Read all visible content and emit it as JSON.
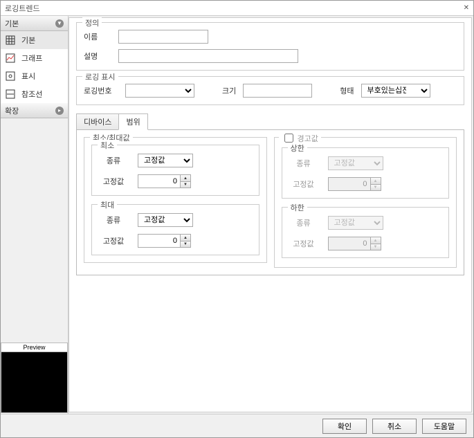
{
  "window": {
    "title": "로깅트렌드"
  },
  "sidebar": {
    "sections": [
      {
        "label": "기본",
        "items": [
          {
            "label": "기본",
            "icon": "table-icon",
            "selected": true
          },
          {
            "label": "그래프",
            "icon": "chart-icon"
          },
          {
            "label": "표시",
            "icon": "eye-icon"
          },
          {
            "label": "참조선",
            "icon": "line-icon"
          }
        ]
      },
      {
        "label": "확장"
      }
    ],
    "preview_label": "Preview"
  },
  "definition": {
    "legend": "정의",
    "name_label": "이름",
    "name_value": "",
    "desc_label": "설명",
    "desc_value": ""
  },
  "logging": {
    "legend": "로깅 표시",
    "num_label": "로깅번호",
    "num_value": "",
    "size_label": "크기",
    "size_value": "",
    "type_label": "형태",
    "type_value": "부호있는십진수",
    "type_options": [
      "부호있는십진수"
    ]
  },
  "tabs": {
    "device": "디바이스",
    "range": "범위",
    "active": "range"
  },
  "range": {
    "minmax_legend": "최소/최대값",
    "min_legend": "최소",
    "max_legend": "최대",
    "kind_label": "종류",
    "kind_value": "고정값",
    "fixed_label": "고정값",
    "fixed_value": "0",
    "warn_legend": "경고값",
    "warn_checked": false,
    "upper_legend": "상한",
    "lower_legend": "하한"
  },
  "buttons": {
    "ok": "확인",
    "cancel": "취소",
    "help": "도움말"
  }
}
